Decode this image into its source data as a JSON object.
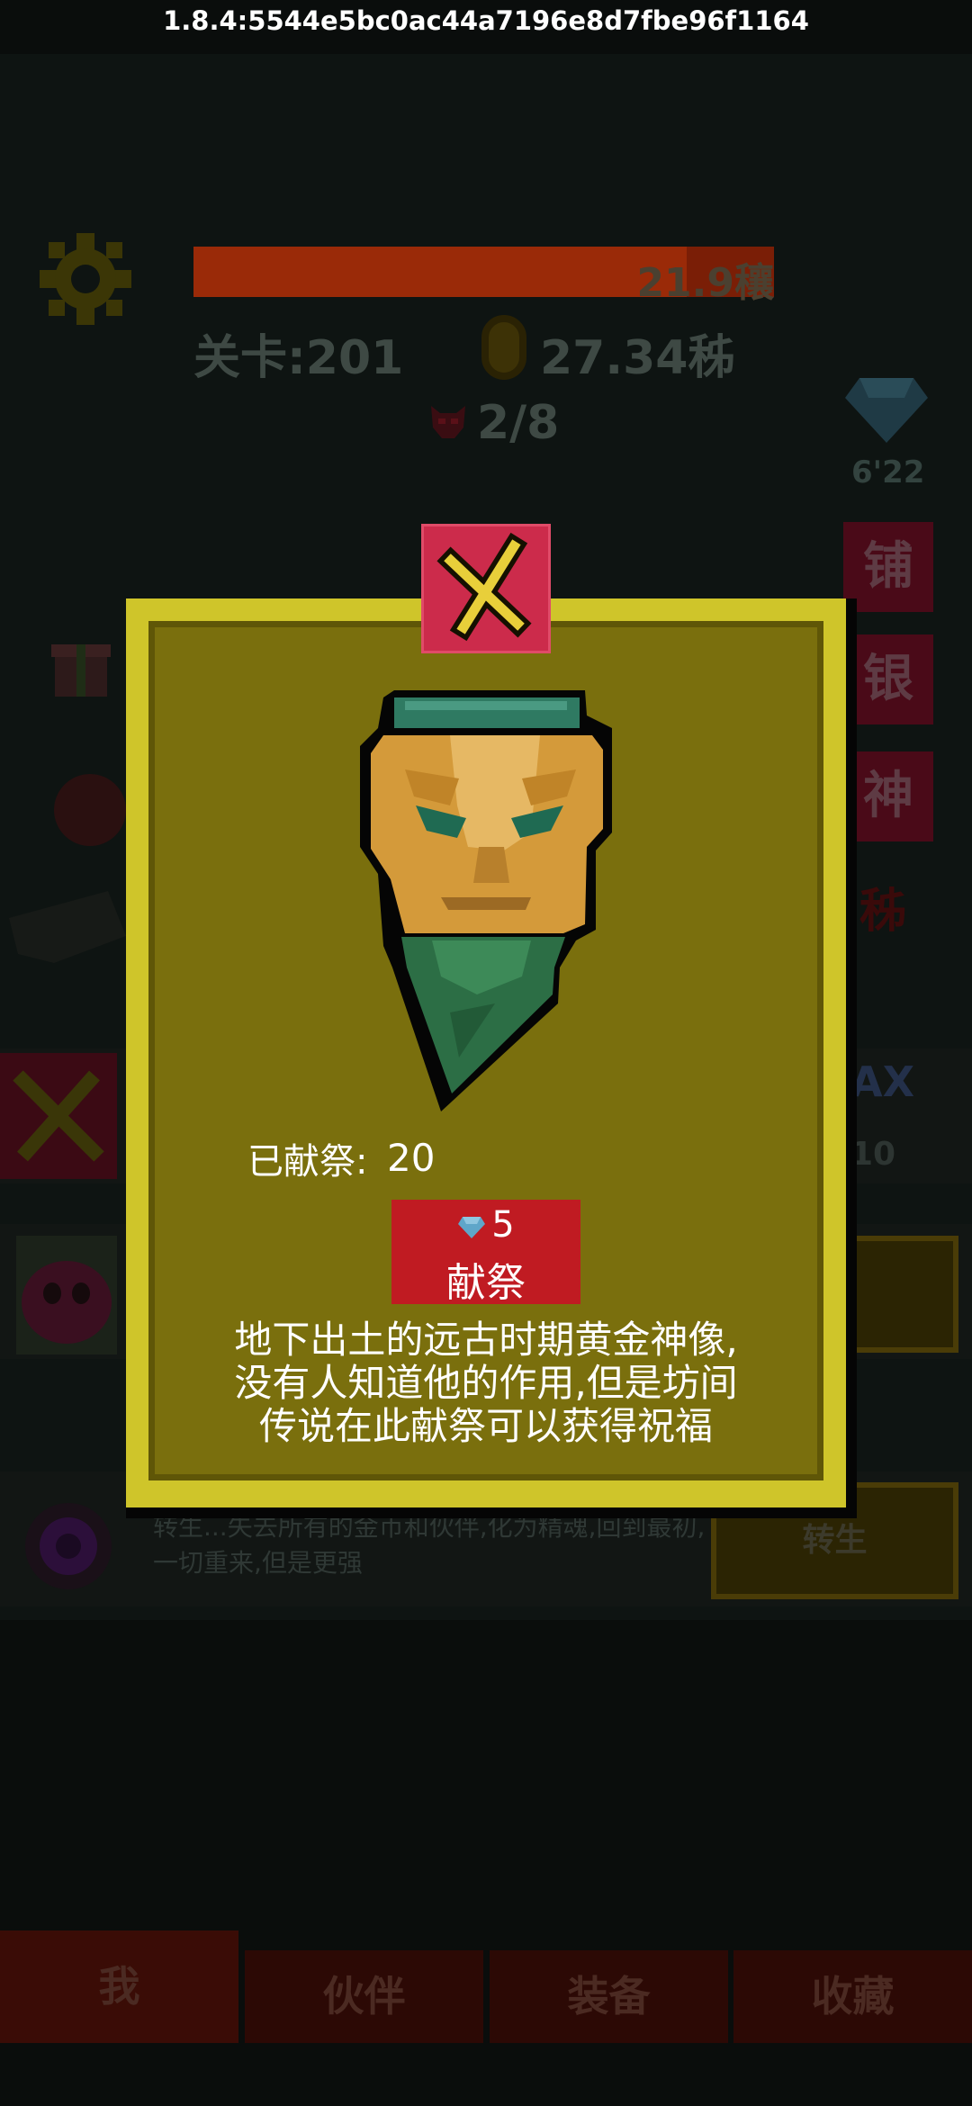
{
  "version": "1.8.4:5544e5bc0ac44a7196e8d7fbe96f1164",
  "hud": {
    "progress_text": "21.9穰",
    "progress_fraction": 0.85,
    "level": "关卡:201",
    "gold": "27.34秭",
    "kills": "2/8",
    "gem_timer": "6'22"
  },
  "side_buttons": [
    "铺",
    "银",
    "神"
  ],
  "side_extra": "秭",
  "rows": {
    "max_label": "AX",
    "max_value": "10",
    "rebirth_desc": "转生...失去所有的金币和伙伴,化为精魂,回到最初,一切重来,但是更强",
    "rebirth_button": "转生"
  },
  "tabs": [
    {
      "label": "我",
      "active": true
    },
    {
      "label": "伙伴",
      "active": false
    },
    {
      "label": "装备",
      "active": false
    },
    {
      "label": "收藏",
      "active": false
    }
  ],
  "modal": {
    "offered_label": "已献祭:",
    "offered_count": "20",
    "offer_cost": "5",
    "offer_label": "献祭",
    "description_lines": [
      "地下出土的远古时期黄金神像,",
      "没有人知道他的作用,但是坊间",
      "传说在此献祭可以获得祝福"
    ]
  },
  "colors": {
    "modal_border": "#cfc52a",
    "modal_fill": "#7a6f0d",
    "close_button": "#cc2b4b",
    "offer_button": "#c01b22",
    "gem": "#5fa6c9"
  }
}
